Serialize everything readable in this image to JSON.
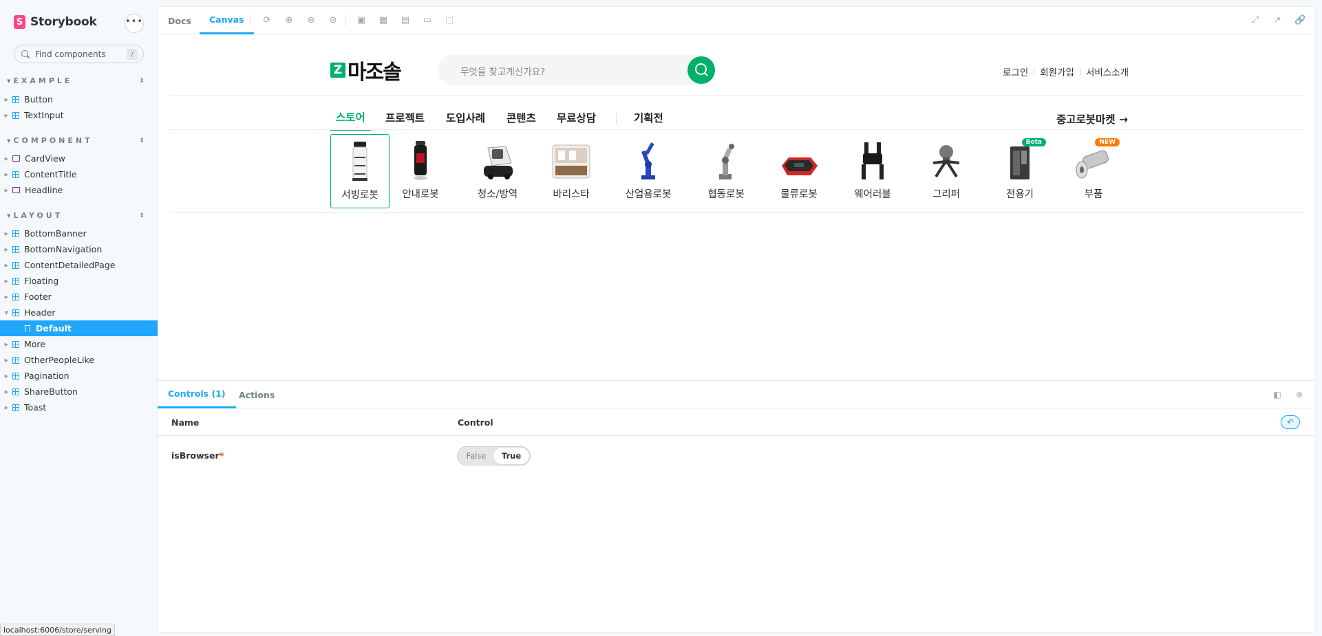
{
  "sidebar": {
    "brand": "Storybook",
    "menu_label": "•••",
    "search": {
      "placeholder": "Find components",
      "shortcut": "/"
    },
    "sections": [
      {
        "title": "EXAMPLE",
        "items": [
          "Button",
          "TextInput"
        ]
      },
      {
        "title": "COMPONENT",
        "items": [
          "CardView",
          "ContentTitle",
          "Headline"
        ]
      },
      {
        "title": "LAYOUT",
        "items": [
          "BottomBanner",
          "BottomNavigation",
          "ContentDetailedPage",
          "Floating",
          "Footer",
          "Header",
          "Default",
          "More",
          "OtherPeopleLike",
          "Pagination",
          "ShareButton",
          "Toast"
        ]
      }
    ],
    "selected_story": "Default"
  },
  "status_bar": {
    "url": "localhost:6006/store/serving"
  },
  "toolbar": {
    "tabs": [
      "Docs",
      "Canvas"
    ],
    "active_tab": "Canvas"
  },
  "preview": {
    "logo_text": "마조솔",
    "search_placeholder": "무엇을 찾고계신가요?",
    "auth_links": [
      "로그인",
      "회원가입",
      "서비스소개"
    ],
    "nav": [
      "스토어",
      "프로젝트",
      "도입사례",
      "콘텐츠",
      "무료상담",
      "기획전"
    ],
    "active_nav": "스토어",
    "market_link": "중고로봇마켓 →",
    "categories": [
      {
        "label": "서빙로봇",
        "selected": true
      },
      {
        "label": "안내로봇"
      },
      {
        "label": "청소/방역"
      },
      {
        "label": "바리스타"
      },
      {
        "label": "산업용로봇"
      },
      {
        "label": "협동로봇"
      },
      {
        "label": "물류로봇"
      },
      {
        "label": "웨어러블"
      },
      {
        "label": "그리퍼"
      },
      {
        "label": "전용기",
        "badge": "Beta"
      },
      {
        "label": "부품",
        "badge": "NEW"
      }
    ],
    "colors": {
      "brand": "#00b06b",
      "beta_badge": "#00b06b",
      "new_badge": "#ff7a00"
    }
  },
  "addons": {
    "tabs": [
      "Controls (1)",
      "Actions"
    ],
    "active_tab": "Controls (1)",
    "columns": [
      "Name",
      "Control"
    ],
    "args": [
      {
        "name": "isBrowser",
        "required_mark": "*",
        "options": [
          "False",
          "True"
        ],
        "value": "True"
      }
    ]
  },
  "colors": {
    "accent": "#1ea7fd",
    "storybook_pink": "#ff4785"
  }
}
